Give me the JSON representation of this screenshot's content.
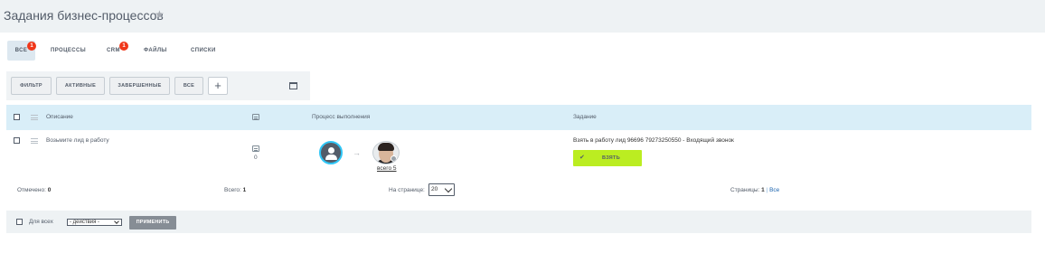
{
  "header": {
    "title": "Задания бизнес-процессов",
    "star_icon": "star-icon"
  },
  "tabs": [
    {
      "label": "ВСЕ",
      "badge": "1"
    },
    {
      "label": "ПРОЦЕССЫ"
    },
    {
      "label": "CRM",
      "badge": "1"
    },
    {
      "label": "ФАЙЛЫ"
    },
    {
      "label": "СПИСКИ"
    }
  ],
  "filters": {
    "buttons": [
      "ФИЛЬТР",
      "АКТИВНЫЕ",
      "ЗАВЕРШЕННЫЕ",
      "ВСЕ"
    ],
    "add_label": "+"
  },
  "grid": {
    "columns": {
      "description": "Описание",
      "process": "Процесс выполнения",
      "task": "Задание"
    },
    "rows": [
      {
        "description": "Возьмите лид в работу",
        "comments": "0",
        "total": "всего 5",
        "task": "Взять в работу лид 96696 79273250550 - Входящий звонок",
        "action_label": "ВЗЯТЬ"
      }
    ]
  },
  "footer": {
    "marked_label": "Отмечено:",
    "marked_value": "0",
    "total_label": "Всего:",
    "total_value": "1",
    "per_page_label": "На странице:",
    "per_page_value": "20",
    "pages_label": "Страницы:",
    "pages_current": "1",
    "pages_sep": "|",
    "pages_all": "Все"
  },
  "actions": {
    "for_all_label": "Для всех",
    "select_value": "- действия -",
    "apply_label": "ПРИМЕНИТЬ"
  },
  "colors": {
    "accent_green": "#bbed21",
    "badge_red": "#f0371a",
    "header_blue": "#d9eef8"
  }
}
